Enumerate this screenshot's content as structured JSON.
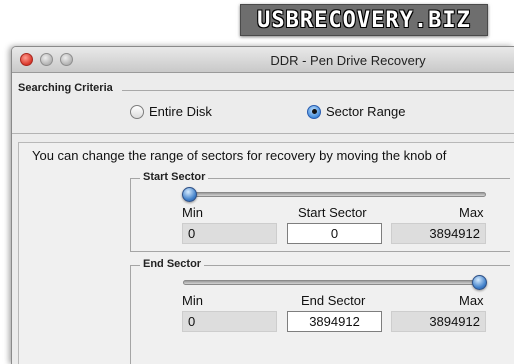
{
  "banner": {
    "text": "USBRECOVERY.BIZ"
  },
  "window": {
    "title": "DDR - Pen Drive Recovery"
  },
  "criteria": {
    "label": "Searching Criteria",
    "options": [
      {
        "label": "Entire Disk",
        "selected": false
      },
      {
        "label": "Sector Range",
        "selected": true
      }
    ]
  },
  "info_text": "You can change the range of sectors for recovery by moving the knob of",
  "start_sector": {
    "group_title": "Start Sector",
    "min_label": "Min",
    "center_label": "Start Sector",
    "max_label": "Max",
    "min_value": "0",
    "value": "0",
    "max_value": "3894912",
    "slider_fraction": 0
  },
  "end_sector": {
    "group_title": "End Sector",
    "min_label": "Min",
    "center_label": "End Sector",
    "max_label": "Max",
    "min_value": "0",
    "value": "3894912",
    "max_value": "3894912",
    "slider_fraction": 1
  },
  "colors": {
    "accent": "#3f7fc9",
    "window_bg": "#ececec",
    "close_light": "#d9362a"
  }
}
